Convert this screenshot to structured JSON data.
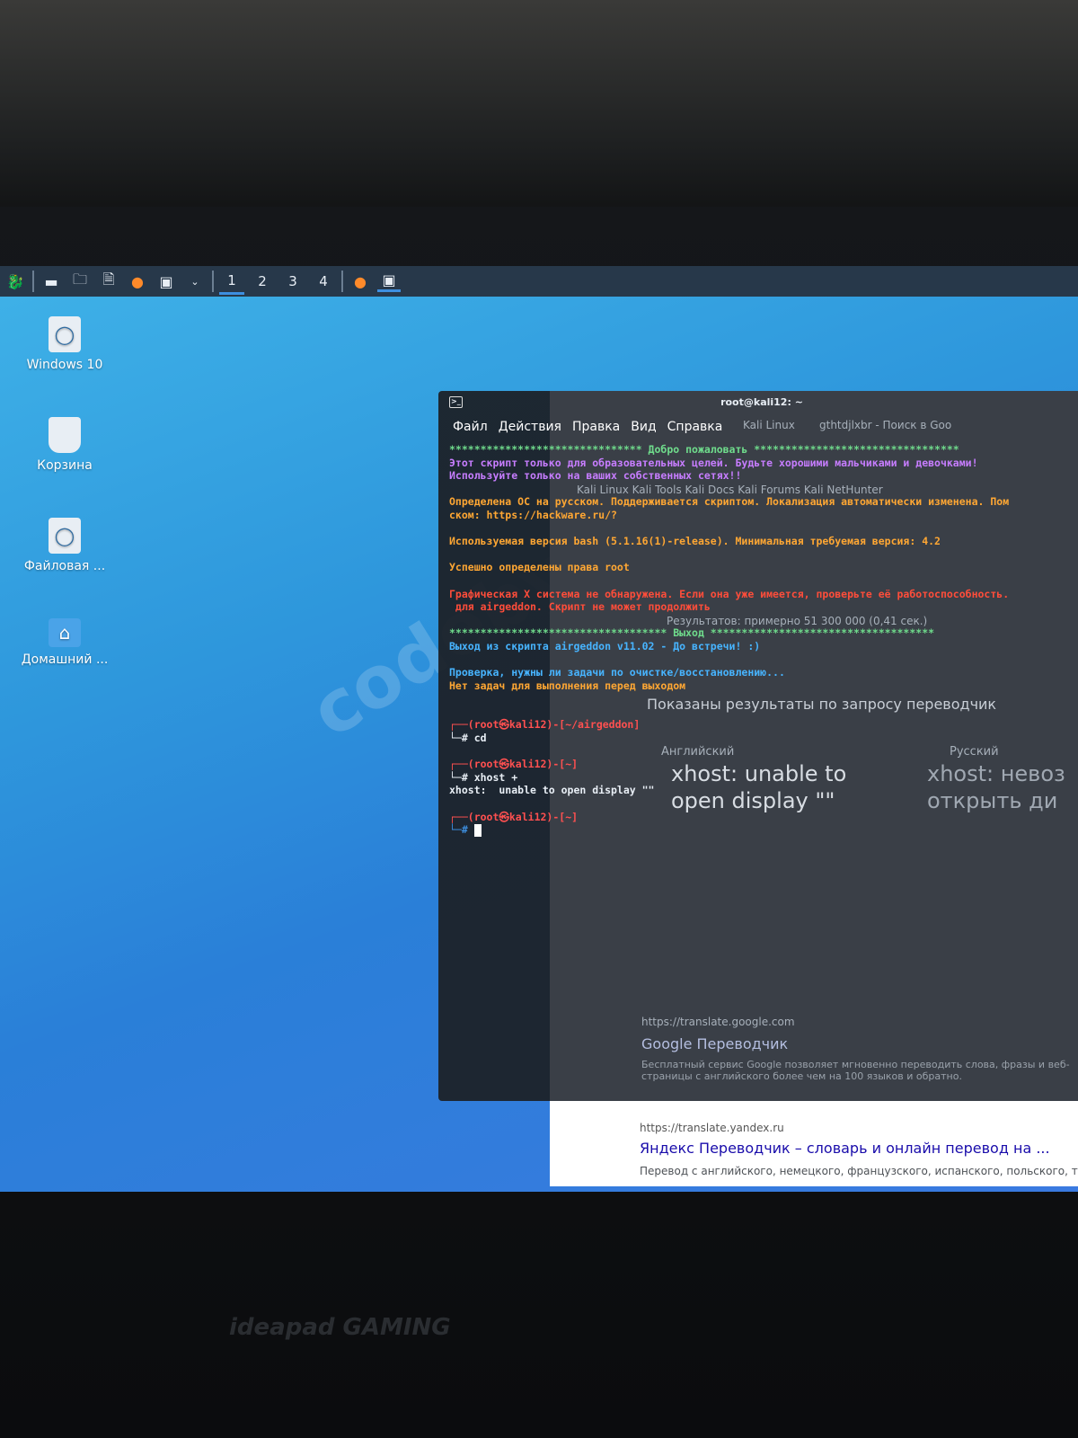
{
  "taskbar": {
    "workspaces": [
      "1",
      "2",
      "3",
      "4"
    ],
    "icons": [
      "kali-menu-icon",
      "desktop-icon",
      "files-icon",
      "text-editor-icon",
      "firefox-icon",
      "terminal-icon"
    ]
  },
  "desktop": {
    "icons": [
      {
        "label": "Windows 10"
      },
      {
        "label": "Корзина"
      },
      {
        "label": "Файловая ..."
      },
      {
        "label": "Домашний ..."
      }
    ]
  },
  "terminal": {
    "title": "root@kali12: ~",
    "menu": [
      "Файл",
      "Действия",
      "Правка",
      "Вид",
      "Справка"
    ],
    "lines": {
      "welcome": "******************************* Добро пожаловать *********************************",
      "edu1": "Этот скрипт только для образовательных целей. Будьте хорошими мальчиками и девочками!",
      "edu2": "Используйте только на ваших собственных сетях!!",
      "os1": "Определена ОС на русском. Поддерживается скриптом. Локализация автоматически изменена. Пом",
      "os2": "ском: https://hackware.ru/?",
      "bash": "Используемая версия bash (5.1.16(1)-release). Минимальная требуемая версия: 4.2",
      "root": "Успешно определены права root",
      "x1": "Графическая X система не обнаружена. Если она уже имеется, проверьте её работоспособность.",
      "x2": " для airgeddon. Скрипт не может продолжить",
      "exit": "*********************************** Выход ************************************",
      "bye": "Выход из скрипта airgeddon v11.02 - До встречи! :)",
      "check": "Проверка, нужны ли задачи по очистке/восстановлению...",
      "notasks": "Нет задач для выполнения перед выходом",
      "p1": "┌──(root㉿kali12)-[~/airgeddon]",
      "c1": "└─# cd",
      "p2": "┌──(root㉿kali12)-[~]",
      "c2": "└─# xhost +",
      "err": "xhost:  unable to open display \"\"",
      "p3": "┌──(root㉿kali12)-[~]",
      "c3": "└─# "
    }
  },
  "browser": {
    "tab1": "Kali Linux",
    "tab2": "gthtdjlxbr - Поиск в Goo",
    "bookmarks": "Kali Linux   Kali Tools   Kali Docs   Kali Forums   Kali NetHunter",
    "results_count": "Результатов: примерно 51 300 000 (0,41 сек.)",
    "shown_for": "Показаны результаты по запросу переводчик",
    "src_lang": "Английский",
    "dst_lang": "Русский",
    "src_text": "xhost:  unable to open display \"\"",
    "dst_text": "xhost: невоз открыть ди",
    "r1_url": "https://translate.google.com",
    "r1_title": "Google Переводчик",
    "r1_desc": "Бесплатный сервис Google позволяет мгновенно переводить слова, фразы и веб-страницы с английского более чем на 100 языков и обратно.",
    "r2_url": "https://translate.yandex.ru",
    "r2_title": "Яндекс Переводчик – словарь и онлайн перевод на ...",
    "r2_desc": "Перевод с английского, немецкого, французского, испанского, польского, турецк"
  },
  "watermark": "codeby.net",
  "laptop_brand": "ideapad GAMING"
}
